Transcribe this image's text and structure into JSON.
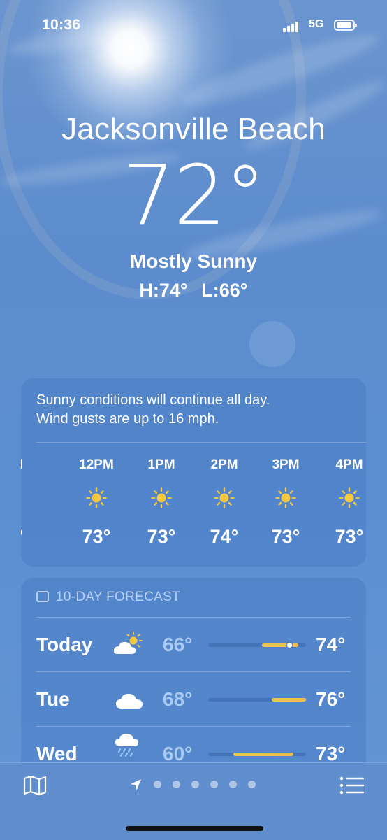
{
  "status": {
    "time": "10:36",
    "network": "5G"
  },
  "location": {
    "city": "Jacksonville Beach",
    "temperature": "72°",
    "condition": "Mostly Sunny",
    "high": "H:74°",
    "low": "L:66°"
  },
  "hourly": {
    "summary_line1": "Sunny conditions will continue all day.",
    "summary_line2": "Wind gusts are up to 16 mph.",
    "partial_left_label": "M",
    "partial_left_temp": "°",
    "hours": [
      {
        "label": "12PM",
        "icon": "sun-icon",
        "temp": "73°"
      },
      {
        "label": "1PM",
        "icon": "sun-icon",
        "temp": "73°"
      },
      {
        "label": "2PM",
        "icon": "sun-icon",
        "temp": "74°"
      },
      {
        "label": "3PM",
        "icon": "sun-icon",
        "temp": "73°"
      },
      {
        "label": "4PM",
        "icon": "sun-icon",
        "temp": "73°"
      }
    ]
  },
  "forecast": {
    "header": "10-DAY FORECAST",
    "days": [
      {
        "day": "Today",
        "icon": "partly-cloudy-icon",
        "low": "66°",
        "high": "74°",
        "range_start": 0.55,
        "range_end": 0.92,
        "current_marker": 0.83
      },
      {
        "day": "Tue",
        "icon": "cloud-icon",
        "low": "68°",
        "high": "76°",
        "range_start": 0.65,
        "range_end": 1.0
      },
      {
        "day": "Wed",
        "icon": "rain-icon",
        "low": "60°",
        "high": "73°",
        "range_start": 0.26,
        "range_end": 0.87
      }
    ]
  },
  "colors": {
    "accent_yellow": "#f5c842",
    "background_blue": "#5c8ccd"
  }
}
